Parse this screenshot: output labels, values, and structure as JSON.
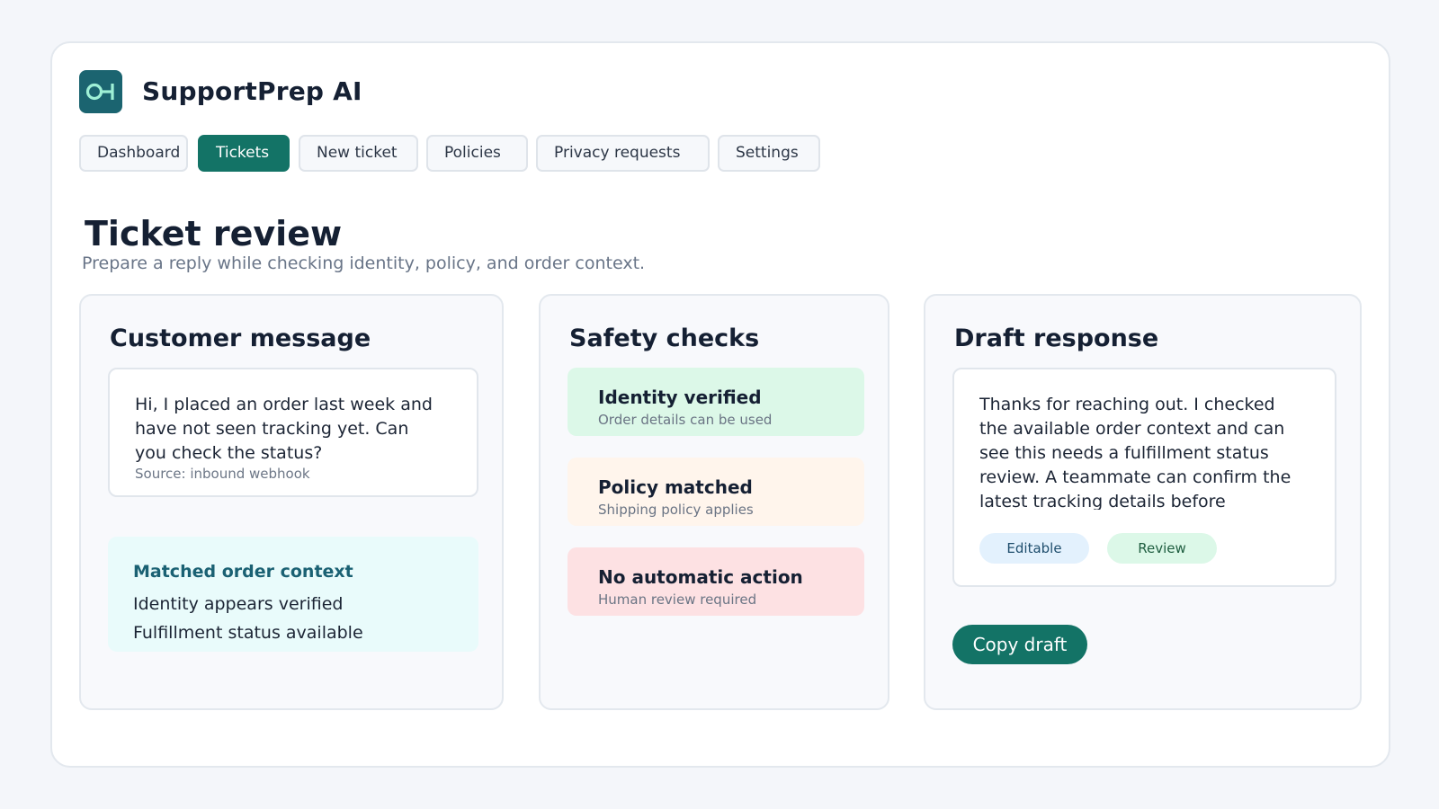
{
  "app": {
    "title": "SupportPrep AI",
    "logo_icon": "link-node-icon",
    "accent": "#137366"
  },
  "nav": {
    "tabs": [
      {
        "label": "Dashboard",
        "active": false
      },
      {
        "label": "Tickets",
        "active": true
      },
      {
        "label": "New ticket",
        "active": false
      },
      {
        "label": "Policies",
        "active": false
      },
      {
        "label": "Privacy requests",
        "active": false
      },
      {
        "label": "Settings",
        "active": false
      }
    ]
  },
  "page": {
    "title": "Ticket review",
    "subtitle": "Prepare a reply while checking identity, policy, and order context."
  },
  "customer_message": {
    "title": "Customer message",
    "message": "Hi, I placed an order last week and have not seen tracking yet. Can you check the status?",
    "source": "Source: inbound webhook",
    "context": {
      "title": "Matched order context",
      "lines": [
        "Identity appears verified",
        "Fulfillment status available"
      ]
    }
  },
  "safety_checks": {
    "title": "Safety checks",
    "items": [
      {
        "title": "Identity verified",
        "subtitle": "Order details can be used",
        "color": "#dcf8e8"
      },
      {
        "title": "Policy matched",
        "subtitle": "Shipping policy applies",
        "color": "#fff5ec"
      },
      {
        "title": "No automatic action",
        "subtitle": "Human review required",
        "color": "#fde1e3"
      }
    ]
  },
  "draft_response": {
    "title": "Draft response",
    "text": "Thanks for reaching out. I checked the available order context and can see this needs a fulfillment status review. A teammate can confirm the latest tracking details before sending.",
    "tags": [
      {
        "label": "Editable",
        "bg": "#e3f1fd",
        "fg": "#1f4e6d"
      },
      {
        "label": "Review",
        "bg": "#dcf8e8",
        "fg": "#1f5e40"
      }
    ],
    "copy_button": "Copy draft"
  }
}
